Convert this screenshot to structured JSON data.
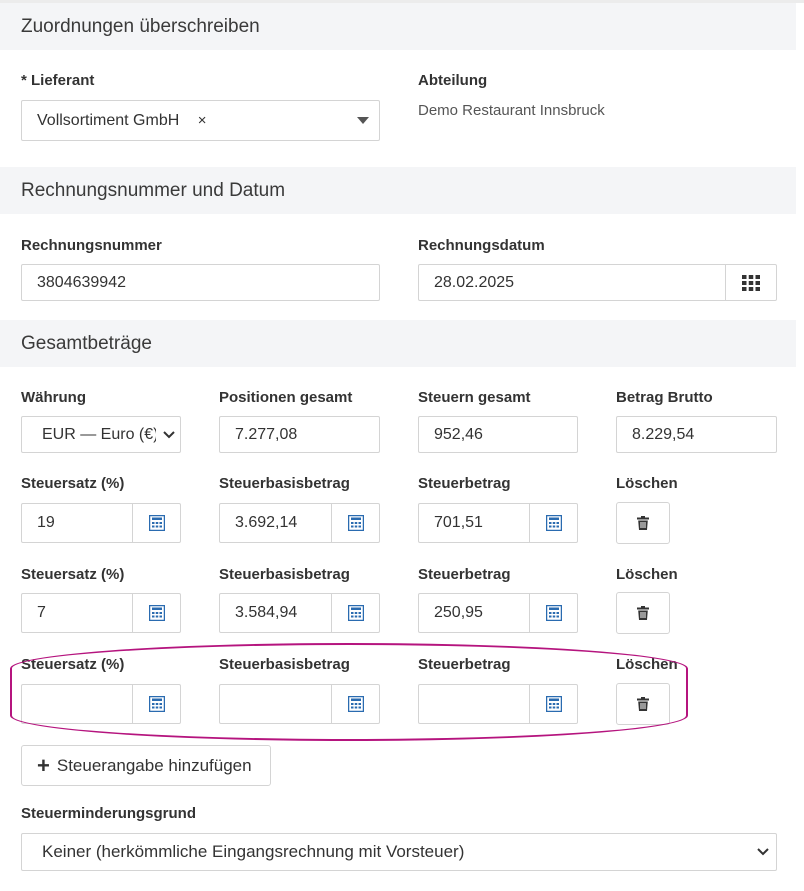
{
  "sections": {
    "assignments": "Zuordnungen überschreiben",
    "invoice": "Rechnungsnummer und Datum",
    "totals": "Gesamtbeträge"
  },
  "supplier": {
    "label": "* Lieferant",
    "value": "Vollsortiment GmbH",
    "clear": "×"
  },
  "department": {
    "label": "Abteilung",
    "value": "Demo Restaurant Innsbruck"
  },
  "invoice_number": {
    "label": "Rechnungsnummer",
    "value": "3804639942"
  },
  "invoice_date": {
    "label": "Rechnungsdatum",
    "value": "28.02.2025"
  },
  "totals": {
    "currency_label": "Währung",
    "currency_value": "EUR — Euro (€)",
    "positions_label": "Positionen gesamt",
    "positions_value": "7.277,08",
    "taxes_label": "Steuern gesamt",
    "taxes_value": "952,46",
    "gross_label": "Betrag Brutto",
    "gross_value": "8.229,54"
  },
  "tax_labels": {
    "rate": "Steuersatz (%)",
    "base": "Steuerbasisbetrag",
    "amount": "Steuerbetrag",
    "delete": "Löschen"
  },
  "tax_rows": [
    {
      "rate": "19",
      "base": "3.692,14",
      "amount": "701,51"
    },
    {
      "rate": "7",
      "base": "3.584,94",
      "amount": "250,95"
    },
    {
      "rate": "",
      "base": "",
      "amount": ""
    }
  ],
  "add_tax_button": "Steuerangabe hinzufügen",
  "reduction": {
    "label": "Steuerminderungsgrund",
    "value": "Keiner (herkömmliche Eingangsrechnung mit Vorsteuer)"
  },
  "colors": {
    "accent": "#2a6bb0",
    "highlight": "#b5147e",
    "section_bg": "#f4f5f7"
  }
}
